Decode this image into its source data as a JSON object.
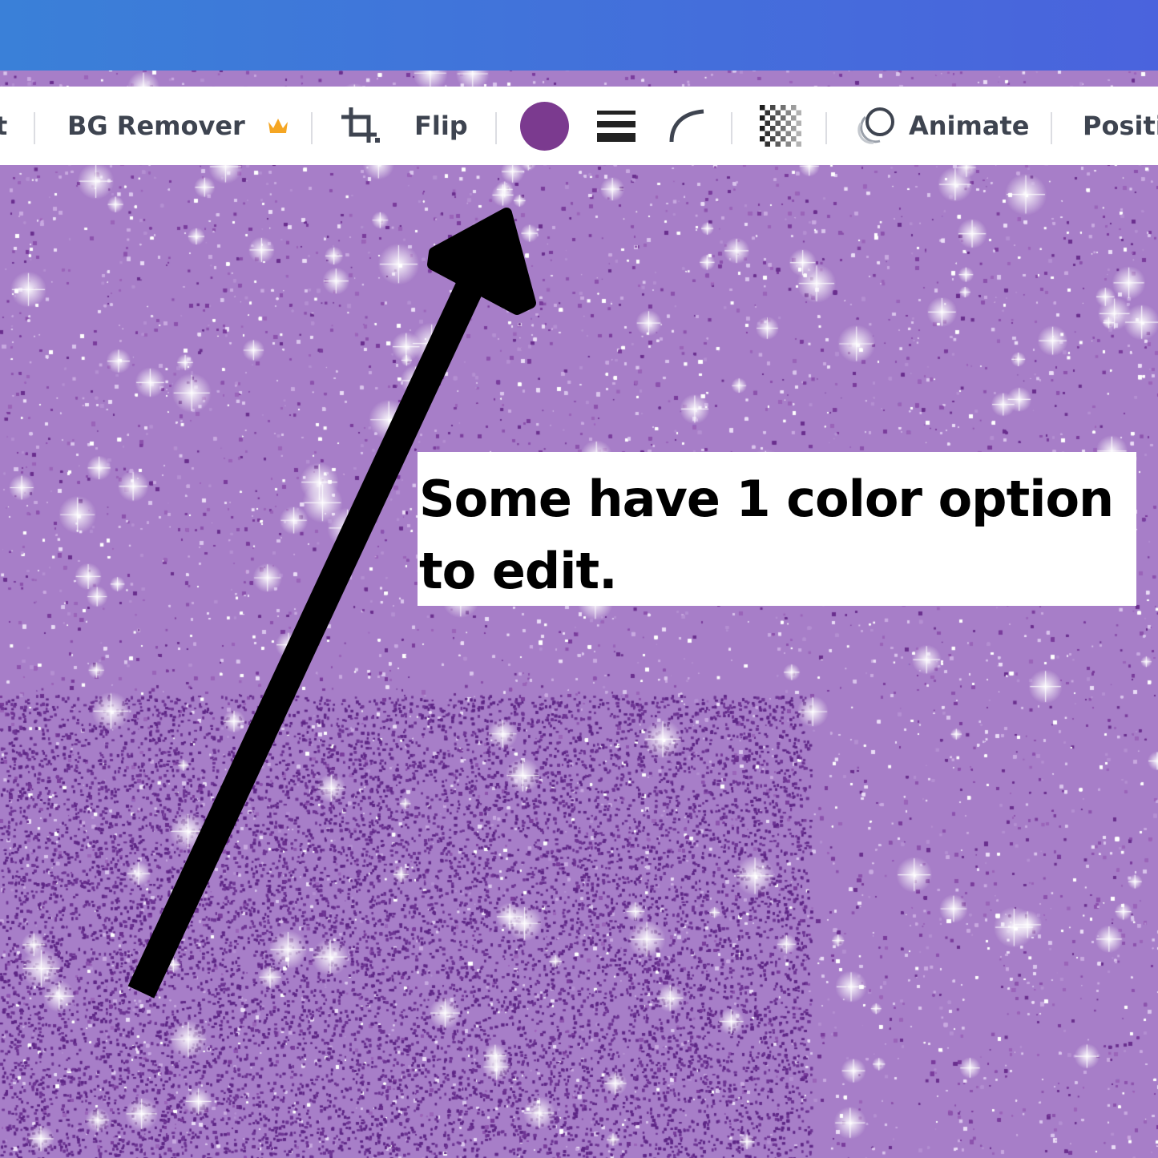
{
  "toolbar": {
    "left_partial_label": "t",
    "bg_remover_label": "BG Remover",
    "flip_label": "Flip",
    "animate_label": "Animate",
    "position_partial_label": "Positi",
    "color_swatch": "#7b3a8f"
  },
  "callout": {
    "text": "Some have 1 color option to edit."
  },
  "colors": {
    "top_bar_start": "#3a80d8",
    "top_bar_end": "#4a63dd",
    "glitter_base": "#a77ec8",
    "crown": "#f5a623"
  }
}
